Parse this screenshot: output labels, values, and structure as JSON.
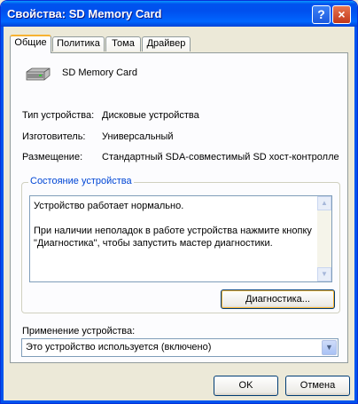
{
  "window": {
    "title": "Свойства: SD Memory Card"
  },
  "titlebar_buttons": {
    "help": "?",
    "close": "×"
  },
  "tabs": [
    {
      "label": "Общие",
      "active": true
    },
    {
      "label": "Политика",
      "active": false
    },
    {
      "label": "Тома",
      "active": false
    },
    {
      "label": "Драйвер",
      "active": false
    }
  ],
  "device": {
    "icon": "drive-icon",
    "name": "SD Memory Card",
    "properties": [
      {
        "label": "Тип устройства:",
        "value": "Дисковые устройства"
      },
      {
        "label": "Изготовитель:",
        "value": "Универсальный"
      },
      {
        "label": "Размещение:",
        "value": "Стандартный SDA-совместимый SD хост-контролле"
      }
    ]
  },
  "status": {
    "group_title": "Состояние устройства",
    "text": "Устройство работает нормально.\n\nПри наличии неполадок в работе устройства нажмите кнопку \"Диагностика\", чтобы запустить мастер диагностики.",
    "diagnostics_button": "Диагностика..."
  },
  "usage": {
    "label": "Применение устройства:",
    "selected": "Это устройство используется (включено)"
  },
  "buttons": {
    "ok": "OK",
    "cancel": "Отмена"
  },
  "colors": {
    "titlebar": "#0053ee",
    "tab_highlight": "#f7b232",
    "group_title": "#0046d5"
  }
}
